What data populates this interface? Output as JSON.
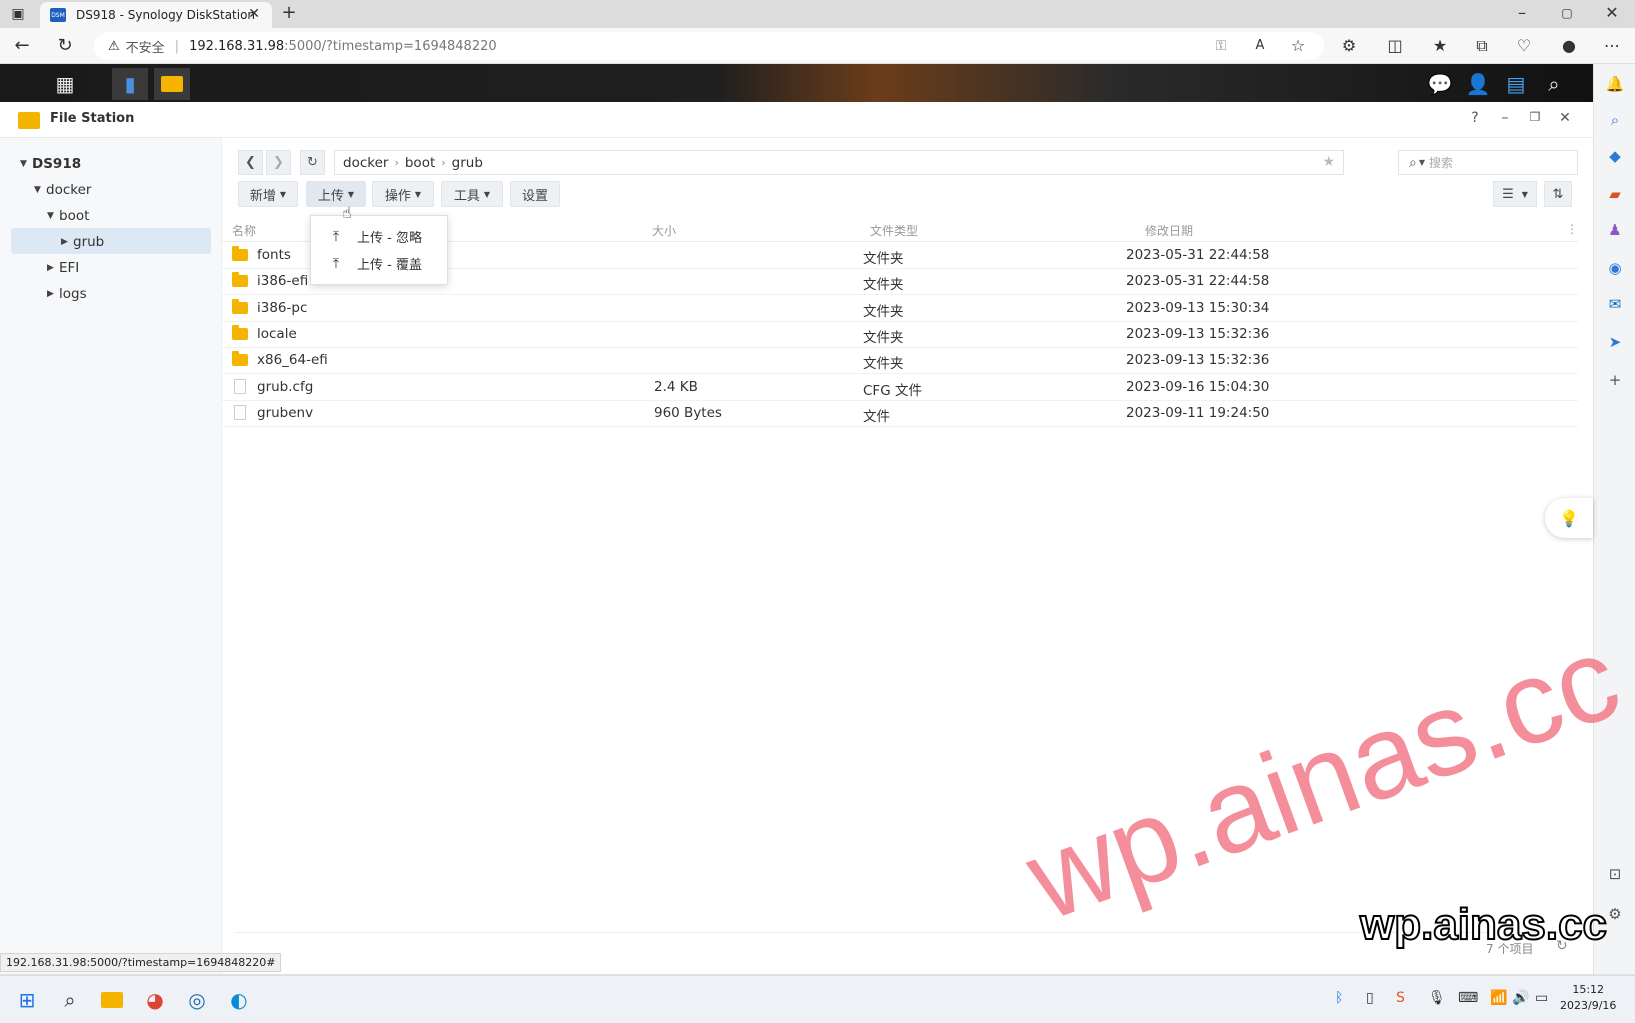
{
  "browser": {
    "tab_title": "DS918 - Synology DiskStation",
    "favicon_text": "DSM",
    "not_secure_label": "不安全",
    "url_host": "192.168.31.98",
    "url_rest": ":5000/?timestamp=1694848220",
    "status_url": "192.168.31.98:5000/?timestamp=1694848220#"
  },
  "window": {
    "title": "File Station"
  },
  "tree": {
    "root": "DS918",
    "items": [
      "docker",
      "boot",
      "grub",
      "EFI",
      "logs"
    ]
  },
  "path": {
    "segments": [
      "docker",
      "boot",
      "grub"
    ]
  },
  "search": {
    "placeholder": "搜索"
  },
  "toolbar": {
    "new_label": "新增",
    "upload_label": "上传",
    "action_label": "操作",
    "tools_label": "工具",
    "settings_label": "设置"
  },
  "upload_menu": {
    "items": [
      "上传 - 忽略",
      "上传 - 覆盖"
    ]
  },
  "table": {
    "headers": [
      "名称",
      "大小",
      "文件类型",
      "修改日期"
    ],
    "rows": [
      {
        "name": "fonts",
        "size": "",
        "type": "文件夹",
        "modified": "2023-05-31 22:44:58",
        "icon": "folder"
      },
      {
        "name": "i386-efi",
        "size": "",
        "type": "文件夹",
        "modified": "2023-05-31 22:44:58",
        "icon": "folder"
      },
      {
        "name": "i386-pc",
        "size": "",
        "type": "文件夹",
        "modified": "2023-09-13 15:30:34",
        "icon": "folder"
      },
      {
        "name": "locale",
        "size": "",
        "type": "文件夹",
        "modified": "2023-09-13 15:32:36",
        "icon": "folder"
      },
      {
        "name": "x86_64-efi",
        "size": "",
        "type": "文件夹",
        "modified": "2023-09-13 15:32:36",
        "icon": "folder"
      },
      {
        "name": "grub.cfg",
        "size": "2.4 KB",
        "type": "CFG 文件",
        "modified": "2023-09-16 15:04:30",
        "icon": "file"
      },
      {
        "name": "grubenv",
        "size": "960 Bytes",
        "type": "文件",
        "modified": "2023-09-11 19:24:50",
        "icon": "file"
      }
    ]
  },
  "status": {
    "item_count": "7 个项目"
  },
  "taskbar": {
    "time": "15:12",
    "date": "2023/9/16"
  },
  "watermark": {
    "big": "wp.ainas.cc",
    "small": "wp.ainas.cc"
  },
  "colors": {
    "folder": "#f5b400",
    "selection": "#dde8f5",
    "watermark": "#f06e7d"
  }
}
